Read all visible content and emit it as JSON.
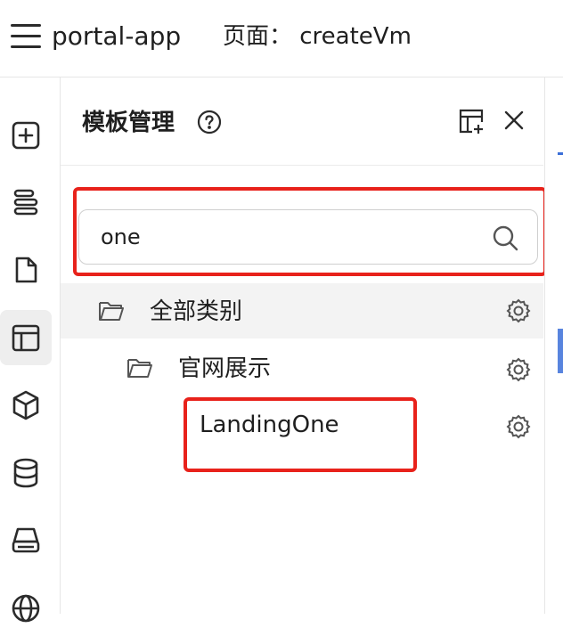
{
  "header": {
    "app_title": "portal-app",
    "page_label": "页面：  createVm"
  },
  "rail": {
    "items": [
      {
        "name": "add-square-icon"
      },
      {
        "name": "layers-icon"
      },
      {
        "name": "file-icon"
      },
      {
        "name": "layout-template-icon",
        "active": true
      },
      {
        "name": "cube-icon"
      },
      {
        "name": "database-icon"
      },
      {
        "name": "inbox-tray-icon"
      },
      {
        "name": "globe-icon"
      }
    ]
  },
  "panel": {
    "title": "模板管理",
    "search": {
      "value": "one",
      "placeholder": ""
    },
    "tree": [
      {
        "label": "全部类别",
        "level": 0,
        "selected": true
      },
      {
        "label": "官网展示",
        "level": 1
      },
      {
        "label": "LandingOne",
        "level": 2
      }
    ]
  },
  "colors": {
    "highlight": "#e8221b",
    "selected_row": "#f3f3f3",
    "accent": "#3b6fd8"
  }
}
